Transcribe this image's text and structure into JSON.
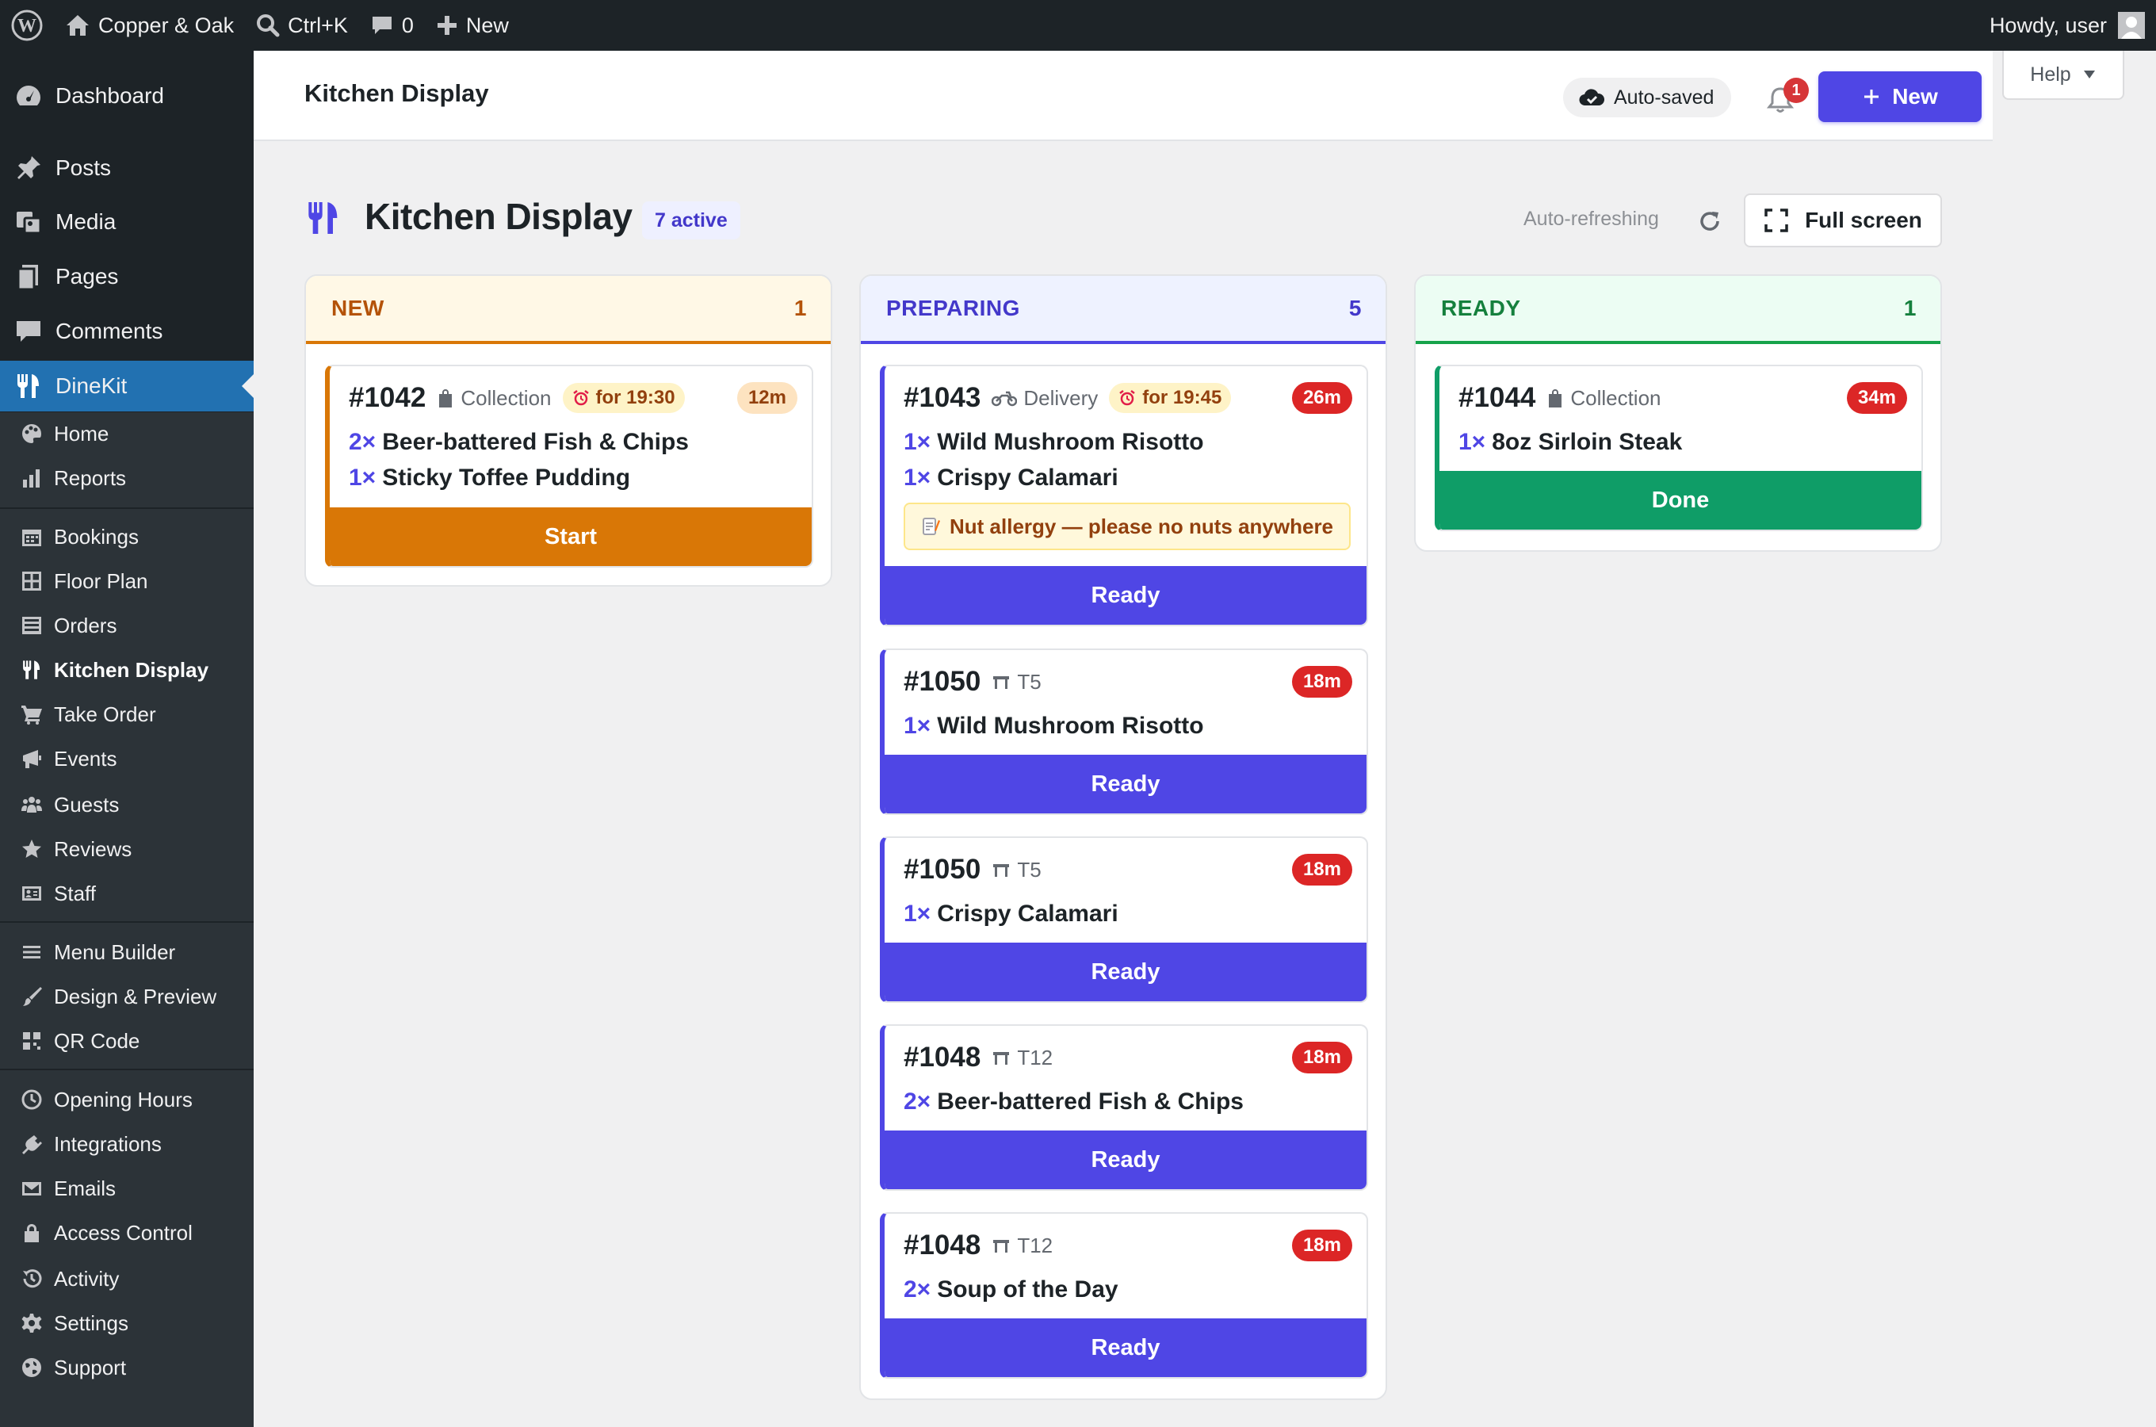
{
  "admin_bar": {
    "site_name": "Copper & Oak",
    "search_shortcut": "Ctrl+K",
    "comments_count": "0",
    "new_label": "New",
    "howdy": "Howdy, user"
  },
  "sidebar": {
    "top_items": [
      {
        "label": "Dashboard",
        "icon": "dashboard-icon"
      },
      {
        "label": "Posts",
        "icon": "pin-icon"
      },
      {
        "label": "Media",
        "icon": "media-icon"
      },
      {
        "label": "Pages",
        "icon": "pages-icon"
      },
      {
        "label": "Comments",
        "icon": "comment-icon"
      },
      {
        "label": "DineKit",
        "icon": "utensils-icon",
        "active": true
      }
    ],
    "sub_items": [
      {
        "label": "Home",
        "icon": "palette-icon"
      },
      {
        "label": "Reports",
        "icon": "bar-chart-icon"
      },
      {
        "label": "Bookings",
        "icon": "calendar-icon"
      },
      {
        "label": "Floor Plan",
        "icon": "grid-icon"
      },
      {
        "label": "Orders",
        "icon": "list-icon"
      },
      {
        "label": "Kitchen Display",
        "icon": "utensils-icon",
        "current": true
      },
      {
        "label": "Take Order",
        "icon": "cart-icon"
      },
      {
        "label": "Events",
        "icon": "megaphone-icon"
      },
      {
        "label": "Guests",
        "icon": "groups-icon"
      },
      {
        "label": "Reviews",
        "icon": "star-icon"
      },
      {
        "label": "Staff",
        "icon": "id-card-icon"
      },
      {
        "label": "Menu Builder",
        "icon": "menu-lines-icon"
      },
      {
        "label": "Design & Preview",
        "icon": "brush-icon"
      },
      {
        "label": "QR Code",
        "icon": "qr-code-icon"
      },
      {
        "label": "Opening Hours",
        "icon": "clock-icon"
      },
      {
        "label": "Integrations",
        "icon": "plugin-icon"
      },
      {
        "label": "Emails",
        "icon": "envelope-icon"
      },
      {
        "label": "Access Control",
        "icon": "lock-icon"
      },
      {
        "label": "Activity",
        "icon": "history-icon"
      },
      {
        "label": "Settings",
        "icon": "gear-icon"
      },
      {
        "label": "Support",
        "icon": "globe-icon"
      }
    ]
  },
  "header": {
    "title": "Kitchen Display",
    "autosaved": "Auto-saved",
    "notifications_count": "1",
    "new_button": "New",
    "help": "Help"
  },
  "page": {
    "title": "Kitchen Display",
    "active_badge": "7 active",
    "auto_refreshing": "Auto-refreshing",
    "fullscreen": "Full screen"
  },
  "columns": [
    {
      "key": "new",
      "title": "NEW",
      "count": "1",
      "color": "#d97706",
      "orders": [
        {
          "number": "#1042",
          "type": "Collection",
          "due": "for 19:30",
          "age": "12m",
          "items": [
            {
              "qty": "2×",
              "name": "Beer-battered Fish & Chips"
            },
            {
              "qty": "1×",
              "name": "Sticky Toffee Pudding"
            }
          ],
          "action": "Start"
        }
      ]
    },
    {
      "key": "preparing",
      "title": "PREPARING",
      "count": "5",
      "color": "#4f46e5",
      "orders": [
        {
          "number": "#1043",
          "type": "Delivery",
          "due": "for 19:45",
          "age": "26m",
          "items": [
            {
              "qty": "1×",
              "name": "Wild Mushroom Risotto"
            },
            {
              "qty": "1×",
              "name": "Crispy Calamari"
            }
          ],
          "note": "Nut allergy — please no nuts anywhere",
          "action": "Ready"
        },
        {
          "number": "#1050",
          "type": "T5",
          "age": "18m",
          "items": [
            {
              "qty": "1×",
              "name": "Wild Mushroom Risotto"
            }
          ],
          "action": "Ready"
        },
        {
          "number": "#1050",
          "type": "T5",
          "age": "18m",
          "items": [
            {
              "qty": "1×",
              "name": "Crispy Calamari"
            }
          ],
          "action": "Ready"
        },
        {
          "number": "#1048",
          "type": "T12",
          "age": "18m",
          "items": [
            {
              "qty": "2×",
              "name": "Beer-battered Fish & Chips"
            }
          ],
          "action": "Ready"
        },
        {
          "number": "#1048",
          "type": "T12",
          "age": "18m",
          "items": [
            {
              "qty": "2×",
              "name": "Soup of the Day"
            }
          ],
          "action": "Ready"
        }
      ]
    },
    {
      "key": "ready",
      "title": "READY",
      "count": "1",
      "color": "#16a34a",
      "orders": [
        {
          "number": "#1044",
          "type": "Collection",
          "age": "34m",
          "items": [
            {
              "qty": "1×",
              "name": "8oz Sirloin Steak"
            }
          ],
          "action": "Done"
        }
      ]
    }
  ]
}
